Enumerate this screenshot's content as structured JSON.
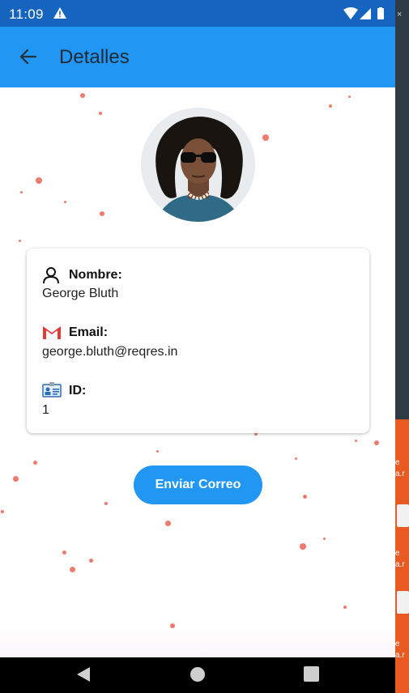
{
  "status_bar": {
    "time": "11:09",
    "warning_icon": "warning-icon",
    "wifi_icon": "wifi-icon",
    "signal_icon": "signal-icon",
    "battery_icon": "battery-icon"
  },
  "app_bar": {
    "title": "Detalles",
    "back_icon": "arrow-back-icon",
    "background": "#2196f3"
  },
  "profile": {
    "avatar_icon": "avatar-photo",
    "fields": [
      {
        "icon": "person-outline-icon",
        "label": "Nombre:",
        "value": "George Bluth"
      },
      {
        "icon": "gmail-icon",
        "label": "Email:",
        "value": "george.bluth@reqres.in"
      },
      {
        "icon": "id-card-icon",
        "label": "ID:",
        "value": "1"
      }
    ]
  },
  "actions": {
    "send_label": "Enviar Correo",
    "accent": "#2196f3"
  },
  "decor": {
    "dot_color": "#ef7a6e"
  },
  "nav_bar": {
    "back_icon": "nav-back-icon",
    "home_icon": "nav-home-icon",
    "recents_icon": "nav-recents-icon"
  },
  "background_window": {
    "labels": [
      "e",
      "a.r",
      "e",
      "a.r",
      "e",
      "a.r"
    ]
  }
}
